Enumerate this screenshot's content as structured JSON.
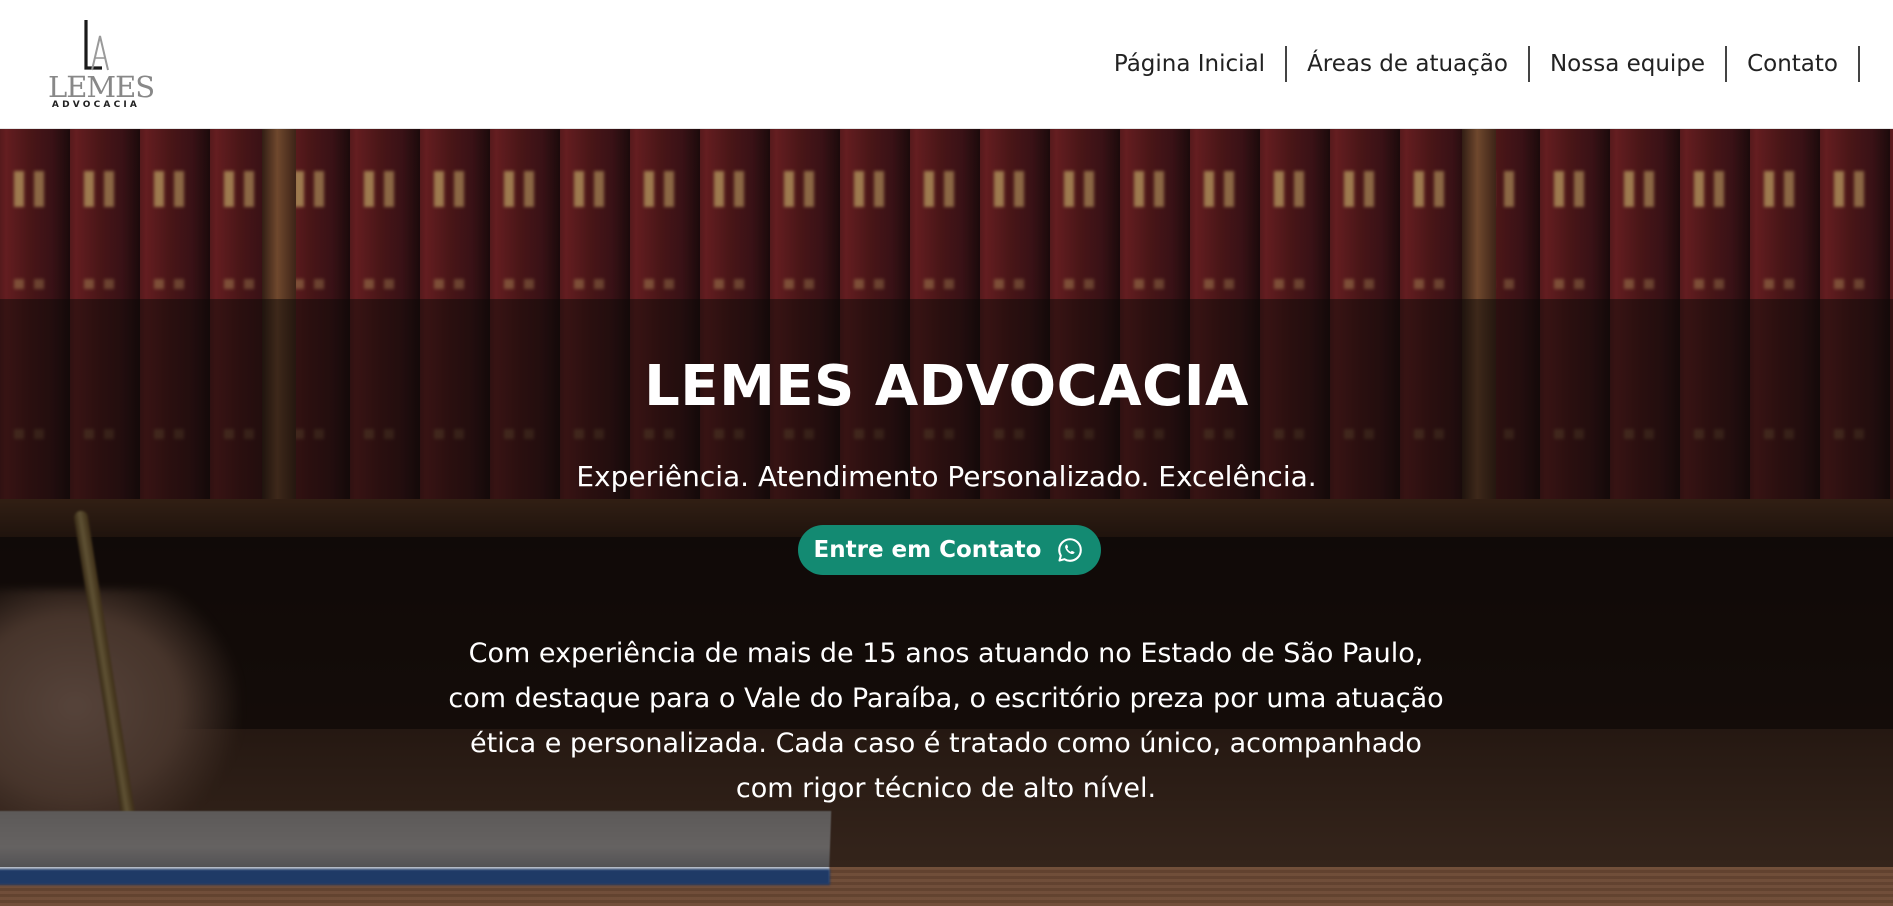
{
  "brand": {
    "logo_word": "LEMES",
    "logo_sub": "ADVOCACIA"
  },
  "nav": {
    "items": [
      {
        "label": "Página Inicial"
      },
      {
        "label": "Áreas de atuação"
      },
      {
        "label": "Nossa equipe"
      },
      {
        "label": "Contato"
      }
    ]
  },
  "hero": {
    "title": "LEMES ADVOCACIA",
    "tagline": "Experiência. Atendimento Personalizado. Excelência.",
    "cta_label": "Entre em Contato",
    "cta_icon": "whatsapp-icon",
    "description": "Com experiência de mais de 15 anos atuando no Estado de São Paulo, com destaque para o Vale do Paraíba, o escritório preza por uma atuação ética e personalizada. Cada caso é tratado como único, acompanhado com rigor técnico de alto nível."
  },
  "colors": {
    "accent": "#138a72",
    "header_bg": "#ffffff",
    "text_dark": "#222222",
    "text_light": "#ffffff"
  }
}
